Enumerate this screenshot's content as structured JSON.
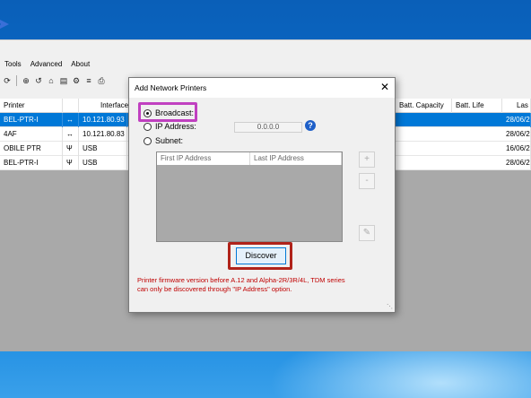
{
  "menu": [
    "Tools",
    "Advanced",
    "About"
  ],
  "toolbar_icons": [
    "refresh-icon",
    "crosshair-icon",
    "undo-icon",
    "home-icon",
    "document-icon",
    "settings-icon",
    "align-icon",
    "add-printer-icon"
  ],
  "grid": {
    "columns": [
      {
        "name": "col-printer",
        "label": "Printer"
      },
      {
        "name": "col-interface",
        "label": "Interface"
      },
      {
        "name": "col-batt-capacity",
        "label": "Batt. Capacity"
      },
      {
        "name": "col-batt-life",
        "label": "Batt. Life"
      },
      {
        "name": "col-last",
        "label": "Las"
      }
    ],
    "rows": [
      {
        "printer": "BEL-PTR-I",
        "iface_icon": "↔",
        "interface": "10.121.80.93",
        "last": "28/06/2",
        "selected": true
      },
      {
        "printer": "4AF",
        "iface_icon": "↔",
        "interface": "10.121.80.83",
        "last": "28/06/2",
        "selected": false
      },
      {
        "printer": "OBILE PTR",
        "iface_icon": "Ψ",
        "interface": "USB",
        "last": "16/06/2",
        "selected": false
      },
      {
        "printer": "BEL-PTR-I",
        "iface_icon": "Ψ",
        "interface": "USB",
        "last": "28/06/2",
        "selected": false
      }
    ]
  },
  "dialog": {
    "title": "Add Network Printers",
    "close": "✕",
    "broadcast_label": "Broadcast:",
    "ip_label": "IP Address:",
    "ip_value": "0.0.0.0",
    "subnet_label": "Subnet:",
    "first_ip_col": "First IP Address",
    "last_ip_col": "Last IP Address",
    "add_btn": "+",
    "remove_btn": "-",
    "edit_btn": "✎",
    "help": "?",
    "discover_label": "Discover",
    "warning_line1": "Printer firmware version before A.12 and Alpha-2R/3R/4L, TDM series",
    "warning_line2": "can only be discovered through \"IP Address\" option."
  },
  "colors": {
    "selection": "#0078d7",
    "highlight_purple": "#c040c0",
    "highlight_red": "#b0231a",
    "warning": "#c00000"
  }
}
